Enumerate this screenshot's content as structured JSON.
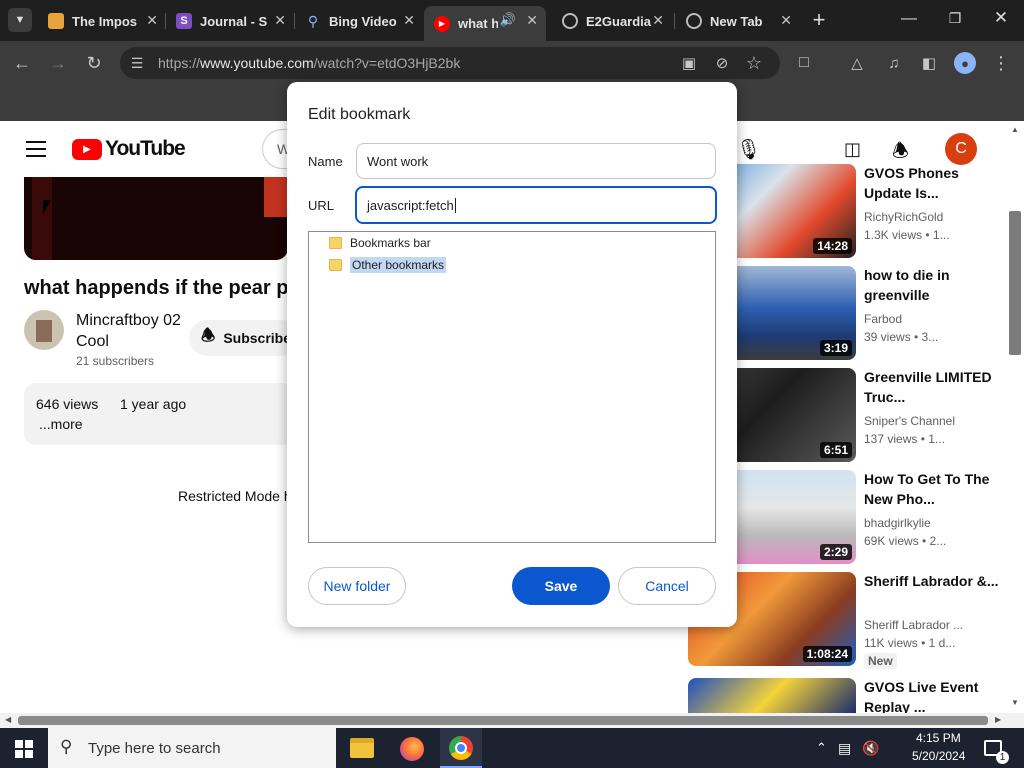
{
  "tabs": [
    {
      "title": "The Impos",
      "favicon": "page-icon"
    },
    {
      "title": "Journal - S",
      "favicon": "s-logo-icon"
    },
    {
      "title": "Bing Video",
      "favicon": "search-icon"
    },
    {
      "title": "what h",
      "favicon": "youtube-icon"
    },
    {
      "title": "E2Guardia",
      "favicon": "globe-icon"
    },
    {
      "title": "New Tab",
      "favicon": "globe-icon"
    }
  ],
  "omnibox": {
    "prefix": "https://",
    "domain": "www.youtube.com",
    "path": "/watch?v=etdO3HjB2bk"
  },
  "youtube": {
    "logo": "YouTube",
    "search_fragment": "W",
    "avatar_letter": "C",
    "video_title": "what happends if the pear pho",
    "channel_name": "Mincraftboy 02 Cool",
    "subscribers": "21 subscribers",
    "subscribe_label": "Subscribe",
    "views": "646 views",
    "age": "1 year ago",
    "more": "...more",
    "restricted": "Restricted Mode h"
  },
  "related": [
    {
      "title": "GVOS Phones Update Is...",
      "channel": "RichyRichGold",
      "meta": "1.3K views • 1...",
      "duration": "14:28",
      "badge": ""
    },
    {
      "title": "how to die in greenville",
      "channel": "Farbod",
      "meta": "39 views • 3...",
      "duration": "3:19",
      "badge": ""
    },
    {
      "title": "Greenville LIMITED Truc...",
      "channel": "Sniper's Channel",
      "meta": "137 views • 1...",
      "duration": "6:51",
      "badge": ""
    },
    {
      "title": "How To Get To The New Pho...",
      "channel": "bhadgirlkylie",
      "meta": "69K views • 2...",
      "duration": "2:29",
      "badge": ""
    },
    {
      "title": "Sheriff Labrador &...",
      "channel": "Sheriff Labrador ...",
      "meta": "11K views • 1 d...",
      "duration": "1:08:24",
      "badge": "New"
    },
    {
      "title": "GVOS Live Event Replay ...",
      "channel": "",
      "meta": "",
      "duration": "",
      "badge": ""
    }
  ],
  "dialog": {
    "title": "Edit bookmark",
    "name_label": "Name",
    "name_value": "Wont work",
    "url_label": "URL",
    "url_value": "javascript:fetch",
    "folders": [
      "Bookmarks bar",
      "Other bookmarks"
    ],
    "new_folder": "New folder",
    "save": "Save",
    "cancel": "Cancel"
  },
  "taskbar": {
    "search_placeholder": "Type here to search",
    "time": "4:15 PM",
    "date": "5/20/2024",
    "notifications": "1"
  },
  "colors": {
    "accent": "#0b57d0",
    "youtube_red": "#ff0000",
    "chrome_dark": "#3c3c3c",
    "avatar": "#d93e10"
  }
}
